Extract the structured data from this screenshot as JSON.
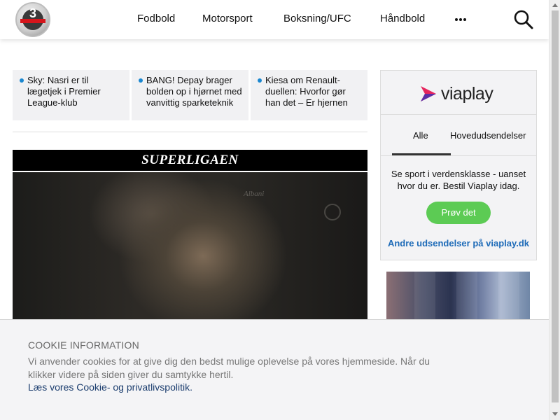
{
  "header": {
    "logo_text": "3",
    "nav": [
      {
        "label": "Fodbold"
      },
      {
        "label": "Motorsport"
      },
      {
        "label": "Boksning/UFC"
      },
      {
        "label": "Håndbold"
      }
    ],
    "more_icon": "more-dots-icon",
    "search_icon": "search-icon"
  },
  "news": [
    {
      "text": "Sky: Nasri er til lægetjek i Premier League-klub"
    },
    {
      "text": "BANG! Depay brager bolden op i hjørnet med vanvittig sparketeknik"
    },
    {
      "text": "Kiesa om Renault-duellen: Hvorfor gør han det – Er hjernen"
    }
  ],
  "feature": {
    "label": "SUPERLIGAEN",
    "jersey_text": "Albani"
  },
  "viaplay": {
    "brand": "viaplay",
    "tabs": [
      "Alle",
      "Hovedudsendelser"
    ],
    "active_tab": "Alle",
    "text": "Se sport i verdensklasse - uanset hvor du er. Bestil Viaplay idag.",
    "button": "Prøv det",
    "link": "Andre udsendelser på viaplay.dk",
    "colors": {
      "button": "#5ccb54",
      "link": "#1e6bb8",
      "logo_pink": "#e6265e",
      "logo_purple": "#5b2ea6"
    }
  },
  "cookie": {
    "title": "COOKIE INFORMATION",
    "text": "Vi anvender cookies for at give dig den bedst mulige oplevelse på vores hjemmeside. Når du klikker videre på siden giver du samtykke hertil.",
    "link": "Læs vores Cookie- og privatlivspolitik."
  }
}
